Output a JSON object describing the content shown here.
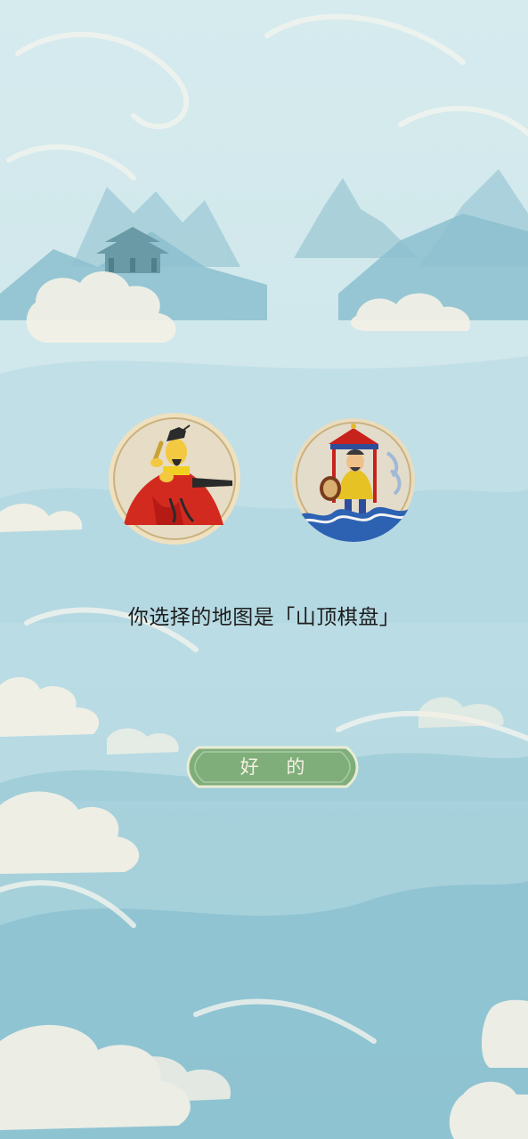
{
  "dialog": {
    "message": "你选择的地图是「山顶棋盘」",
    "ok_label": "好 的"
  },
  "portraits": [
    {
      "icon": "scholar-official-in-red-robe-icon"
    },
    {
      "icon": "warrior-with-drum-on-waves-icon"
    }
  ],
  "theme": {
    "sky": "#cfe6ea",
    "mountain": "#8cc0cf",
    "button_green": "#7fae7b",
    "button_border": "#e9ecd3"
  }
}
